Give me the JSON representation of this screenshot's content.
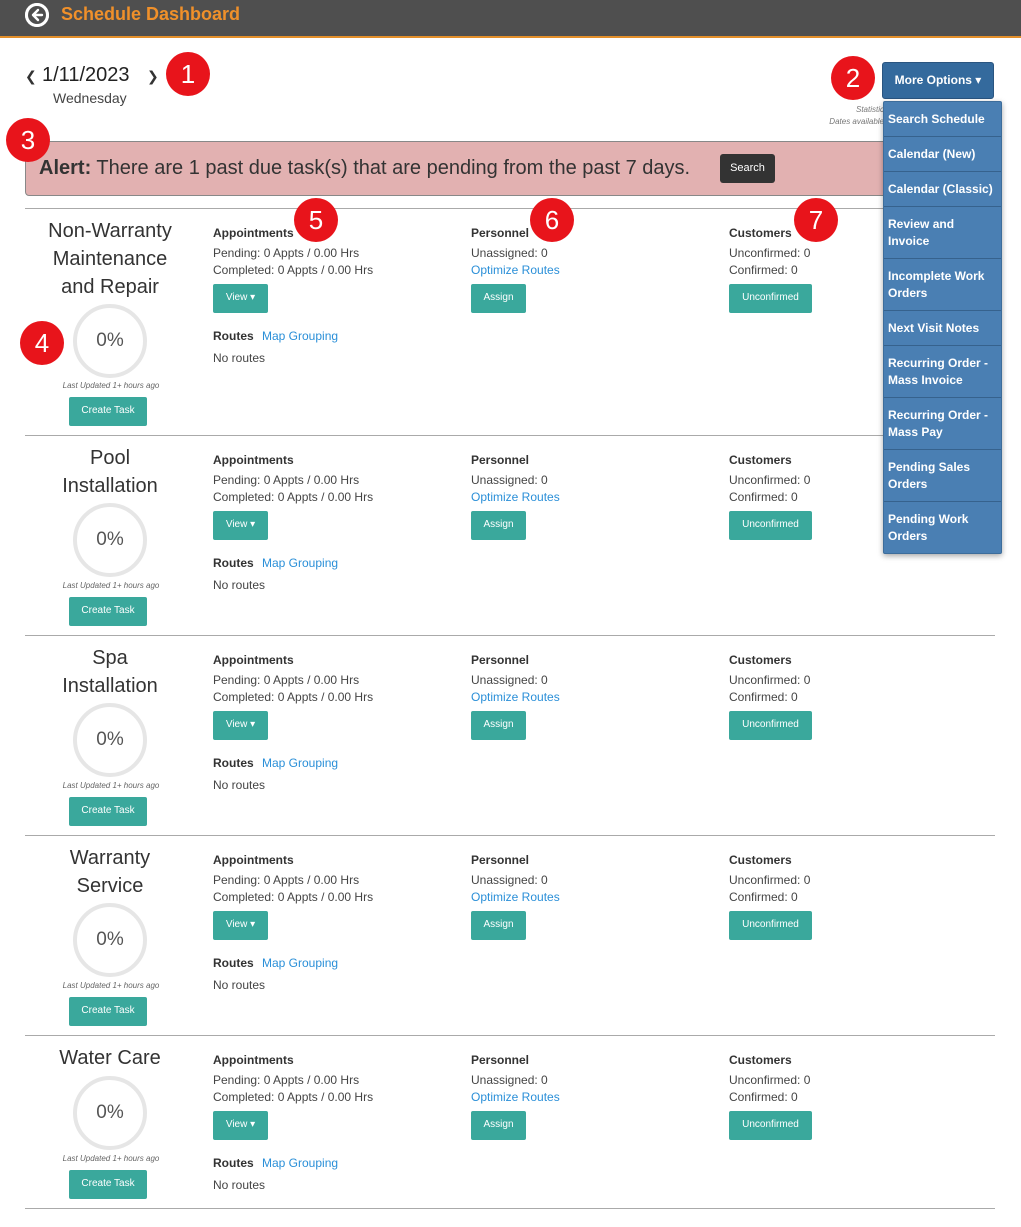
{
  "header": {
    "title": "Schedule Dashboard"
  },
  "date_nav": {
    "date": "1/11/2023",
    "day": "Wednesday"
  },
  "markers": [
    "1",
    "2",
    "3",
    "4",
    "5",
    "6",
    "7"
  ],
  "more_options": {
    "label": "More Options ▾",
    "stats_note_1": "Statistic",
    "stats_note_2": "Dates available",
    "items": [
      "Search Schedule",
      "Calendar (New)",
      "Calendar (Classic)",
      "Review and Invoice",
      "Incomplete Work Orders",
      "Next Visit Notes",
      "Recurring Order - Mass Invoice",
      "Recurring Order - Mass Pay",
      "Pending Sales Orders",
      "Pending Work Orders"
    ]
  },
  "alert": {
    "label": "Alert:",
    "text": " There are 1 past due task(s) that are pending from the past 7 days.",
    "search_label": "Search"
  },
  "common": {
    "appointments_header": "Appointments",
    "personnel_header": "Personnel",
    "customers_header": "Customers",
    "view_label": "View ▾",
    "assign_label": "Assign",
    "unconfirmed_label": "Unconfirmed",
    "routes_label": "Routes",
    "map_grouping_label": "Map Grouping",
    "no_routes": "No routes",
    "optimize_routes": "Optimize Routes",
    "create_task_label": "Create Task",
    "last_updated": "Last Updated 1+ hours ago"
  },
  "sections": [
    {
      "name": [
        "Non-Warranty",
        "Maintenance",
        "and Repair"
      ],
      "percent": "0%",
      "pending": "Pending: 0 Appts / 0.00 Hrs",
      "completed": "Completed: 0 Appts / 0.00 Hrs",
      "unassigned": "Unassigned: 0",
      "unconfirmed": "Unconfirmed: 0",
      "confirmed": "Confirmed: 0"
    },
    {
      "name": [
        "Pool",
        "Installation"
      ],
      "percent": "0%",
      "pending": "Pending: 0 Appts / 0.00 Hrs",
      "completed": "Completed: 0 Appts / 0.00 Hrs",
      "unassigned": "Unassigned: 0",
      "unconfirmed": "Unconfirmed: 0",
      "confirmed": "Confirmed: 0"
    },
    {
      "name": [
        "Spa",
        "Installation"
      ],
      "percent": "0%",
      "pending": "Pending: 0 Appts / 0.00 Hrs",
      "completed": "Completed: 0 Appts / 0.00 Hrs",
      "unassigned": "Unassigned: 0",
      "unconfirmed": "Unconfirmed: 0",
      "confirmed": "Confirmed: 0"
    },
    {
      "name": [
        "Warranty",
        "Service"
      ],
      "percent": "0%",
      "pending": "Pending: 0 Appts / 0.00 Hrs",
      "completed": "Completed: 0 Appts / 0.00 Hrs",
      "unassigned": "Unassigned: 0",
      "unconfirmed": "Unconfirmed: 0",
      "confirmed": "Confirmed: 0"
    },
    {
      "name": [
        "Water Care"
      ],
      "percent": "0%",
      "pending": "Pending: 0 Appts / 0.00 Hrs",
      "completed": "Completed: 0 Appts / 0.00 Hrs",
      "unassigned": "Unassigned: 0",
      "unconfirmed": "Unconfirmed: 0",
      "confirmed": "Confirmed: 0"
    }
  ],
  "colors": {
    "topbar": "#4f4f4f",
    "title_orange": "#f0902a",
    "teal_button": "#3aa89c",
    "menu_blue": "#4a7fb3",
    "alert_bg": "#e2b1b1",
    "marker_red": "#e8141b",
    "link_blue": "#2a8fd8"
  }
}
